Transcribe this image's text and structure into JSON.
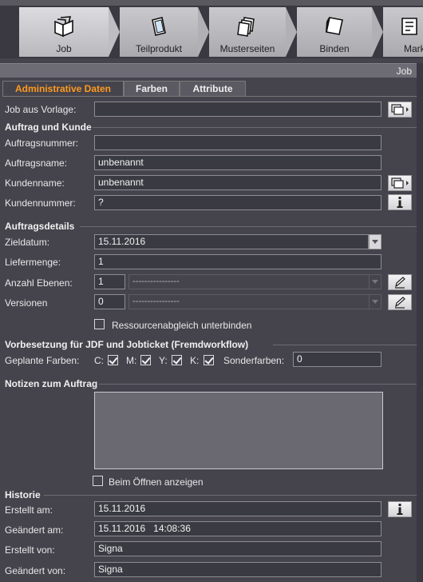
{
  "workflow": {
    "steps": [
      {
        "label": "Job",
        "icon": "job-book-icon",
        "active": true
      },
      {
        "label": "Teilprodukt",
        "icon": "part-product-icon",
        "active": false
      },
      {
        "label": "Musterseiten",
        "icon": "master-pages-icon",
        "active": false
      },
      {
        "label": "Binden",
        "icon": "binding-icon",
        "active": false
      },
      {
        "label": "Mark",
        "icon": "marks-icon",
        "active": false
      }
    ]
  },
  "panel": {
    "title": "Job"
  },
  "tabs": [
    {
      "label": "Administrative Daten",
      "active": true
    },
    {
      "label": "Farben",
      "active": false
    },
    {
      "label": "Attribute",
      "active": false
    }
  ],
  "form": {
    "vorlage": {
      "label": "Job aus Vorlage:",
      "value": ""
    },
    "auftrag_section": "Auftrag und Kunde",
    "auftragsnummer": {
      "label": "Auftragsnummer:",
      "value": ""
    },
    "auftragsname": {
      "label": "Auftragsname:",
      "value": "unbenannt"
    },
    "kundenname": {
      "label": "Kundenname:",
      "value": "unbenannt"
    },
    "kundennummer": {
      "label": "Kundennummer:",
      "value": "?"
    },
    "details_section": "Auftragsdetails",
    "zieldatum": {
      "label": "Zieldatum:",
      "value": "15.11.2016"
    },
    "liefermenge": {
      "label": "Liefermenge:",
      "value": "1"
    },
    "ebenen": {
      "label": "Anzahl Ebenen:",
      "value": "1",
      "combo": "----------------"
    },
    "versionen": {
      "label": "Versionen",
      "value": "0",
      "combo": "----------------"
    },
    "ressourcen": {
      "label": "Ressourcenabgleich unterbinden",
      "checked": false
    },
    "jdf_section": "Vorbesetzung für JDF und Jobticket (Fremdworkflow)",
    "farben": {
      "label": "Geplante Farben:",
      "c": {
        "label": "C:",
        "checked": true
      },
      "m": {
        "label": "M:",
        "checked": true
      },
      "y": {
        "label": "Y:",
        "checked": true
      },
      "k": {
        "label": "K:",
        "checked": true
      },
      "sonder_label": "Sonderfarben:",
      "sonder_value": "0"
    },
    "notizen_section": "Notizen zum Auftrag",
    "notizen_value": "",
    "beim_oeffnen": {
      "label": "Beim Öffnen anzeigen",
      "checked": false
    },
    "historie_section": "Historie",
    "erstellt_am": {
      "label": "Erstellt am:",
      "value": "15.11.2016"
    },
    "geaendert_am": {
      "label": "Geändert am:",
      "value": "15.11.2016   14:08:36"
    },
    "erstellt_von": {
      "label": "Erstellt von:",
      "value": "Signa"
    },
    "geaendert_von": {
      "label": "Geändert von:",
      "value": "Signa"
    }
  },
  "colors": {
    "accent": "#ff9a1f",
    "panel": "#45444d"
  }
}
